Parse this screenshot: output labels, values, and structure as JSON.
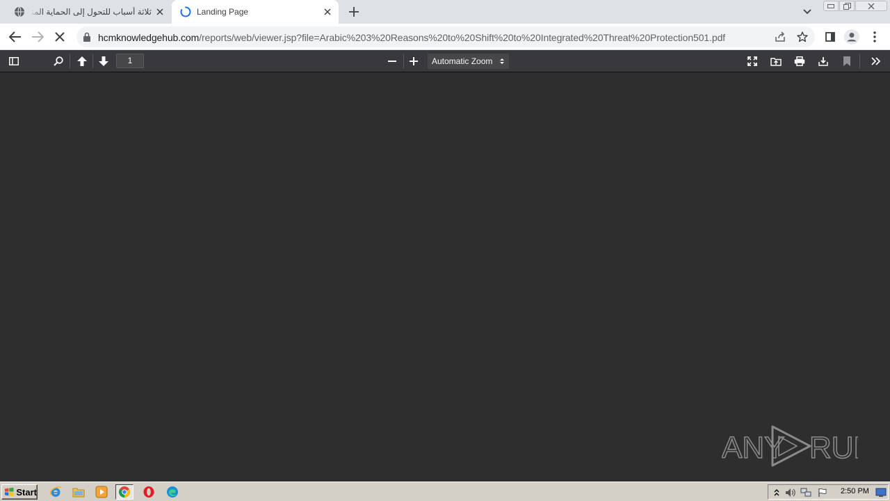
{
  "browser": {
    "tabs": [
      {
        "title": "ثلاثة أسباب للتحول إلى الحماية المتكاملة",
        "active": false,
        "loading": false
      },
      {
        "title": "Landing Page",
        "active": true,
        "loading": true
      }
    ],
    "url": {
      "host": "hcmknowledgehub.com",
      "path": "/reports/web/viewer.jsp?file=Arabic%203%20Reasons%20to%20Shift%20to%20Integrated%20Threat%20Protection501.pdf"
    },
    "accent_color": "#1a73e8"
  },
  "pdf_viewer": {
    "page_number": "1",
    "zoom_label": "Automatic Zoom",
    "background_color": "#2e2e2e",
    "toolbar_color": "#38383d"
  },
  "watermark": {
    "text_left": "ANY",
    "text_right": "RUN"
  },
  "taskbar": {
    "start_label": "Start",
    "pinned": [
      "ie-icon",
      "explorer-folder-icon",
      "media-player-icon",
      "chrome-icon",
      "opera-icon",
      "edge-icon"
    ],
    "clock": "2:50 PM"
  }
}
